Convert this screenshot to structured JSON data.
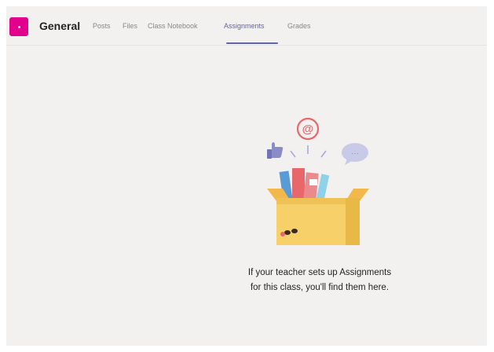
{
  "header": {
    "channel": "General",
    "tabs": [
      {
        "label": "Posts",
        "active": false
      },
      {
        "label": "Files",
        "active": false
      },
      {
        "label": "Class Notebook",
        "active": false
      },
      {
        "label": "Assignments",
        "active": true
      },
      {
        "label": "Grades",
        "active": false
      }
    ]
  },
  "empty_state": {
    "line1": "If your teacher sets up Assignments",
    "line2": "for this class, you'll find them here.",
    "at_glyph": "@",
    "bubble_glyph": "···"
  },
  "colors": {
    "team_tile": "#e3008c",
    "accent": "#6264a7",
    "background": "#f3f1f0",
    "box": "#f7d06a"
  }
}
